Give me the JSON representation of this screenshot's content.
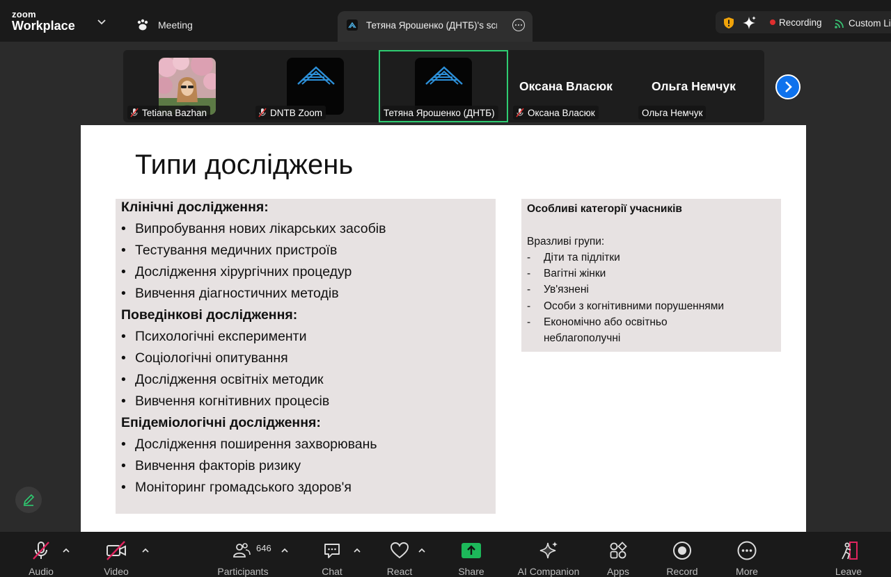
{
  "titlebar": {
    "brand_top": "zoom",
    "brand_bottom": "Workplace",
    "meeting_label": "Meeting",
    "share_tab_label": "Тетяна Ярошенко (ДНТБ)'s scree",
    "recording_label": "Recording",
    "live_label": "Custom Li"
  },
  "gallery": {
    "tiles": [
      {
        "name": "Tetiana Bazhan",
        "muted": true
      },
      {
        "name": "DNTB Zoom",
        "muted": true
      },
      {
        "name": "Тетяна Ярошенко (ДНТБ)",
        "muted": false
      },
      {
        "name": "Оксана Власюк",
        "display": "Оксана Власюк",
        "muted": true
      },
      {
        "name": "Ольга Немчук",
        "display": "Ольга Немчук",
        "muted": false
      }
    ]
  },
  "slide": {
    "title": "Типи досліджень",
    "left": [
      {
        "kind": "head",
        "text": "Клінічні дослідження:"
      },
      {
        "kind": "item",
        "text": "Випробування нових лікарських засобів"
      },
      {
        "kind": "item",
        "text": "Тестування медичних пристроїв"
      },
      {
        "kind": "item",
        "text": "Дослідження хірургічних процедур"
      },
      {
        "kind": "item",
        "text": "Вивчення діагностичних методів"
      },
      {
        "kind": "head",
        "text": "Поведінкові дослідження:"
      },
      {
        "kind": "item",
        "text": "Психологічні експерименти"
      },
      {
        "kind": "item",
        "text": "Соціологічні опитування"
      },
      {
        "kind": "item",
        "text": "Дослідження освітніх методик"
      },
      {
        "kind": "item",
        "text": "Вивчення когнітивних процесів"
      },
      {
        "kind": "head",
        "text": "Епідеміологічні дослідження:"
      },
      {
        "kind": "item",
        "text": "Дослідження поширення захворювань"
      },
      {
        "kind": "item",
        "text": "Вивчення факторів ризику"
      },
      {
        "kind": "item",
        "text": "Моніторинг громадського здоров'я"
      }
    ],
    "bullet": "•",
    "right": {
      "title": "Особливі категорії учасників",
      "subtitle": "Вразливі групи:",
      "dash": "-",
      "items": [
        "Діти та підлітки",
        "Вагітні жінки",
        "Ув'язнені",
        "Особи з когнітивними порушеннями",
        "Економічно або освітньо"
      ],
      "continuation": "неблагополучні"
    }
  },
  "toolbar": {
    "audio": "Audio",
    "video": "Video",
    "participants": "Participants",
    "participants_count": "646",
    "chat": "Chat",
    "react": "React",
    "share": "Share",
    "ai_companion": "AI Companion",
    "apps": "Apps",
    "record": "Record",
    "more": "More",
    "leave": "Leave"
  },
  "colors": {
    "share_green": "#1db85a",
    "active_border": "#2ecc71",
    "record_red": "#e02e2e",
    "accent_blue": "#0e72ed"
  }
}
